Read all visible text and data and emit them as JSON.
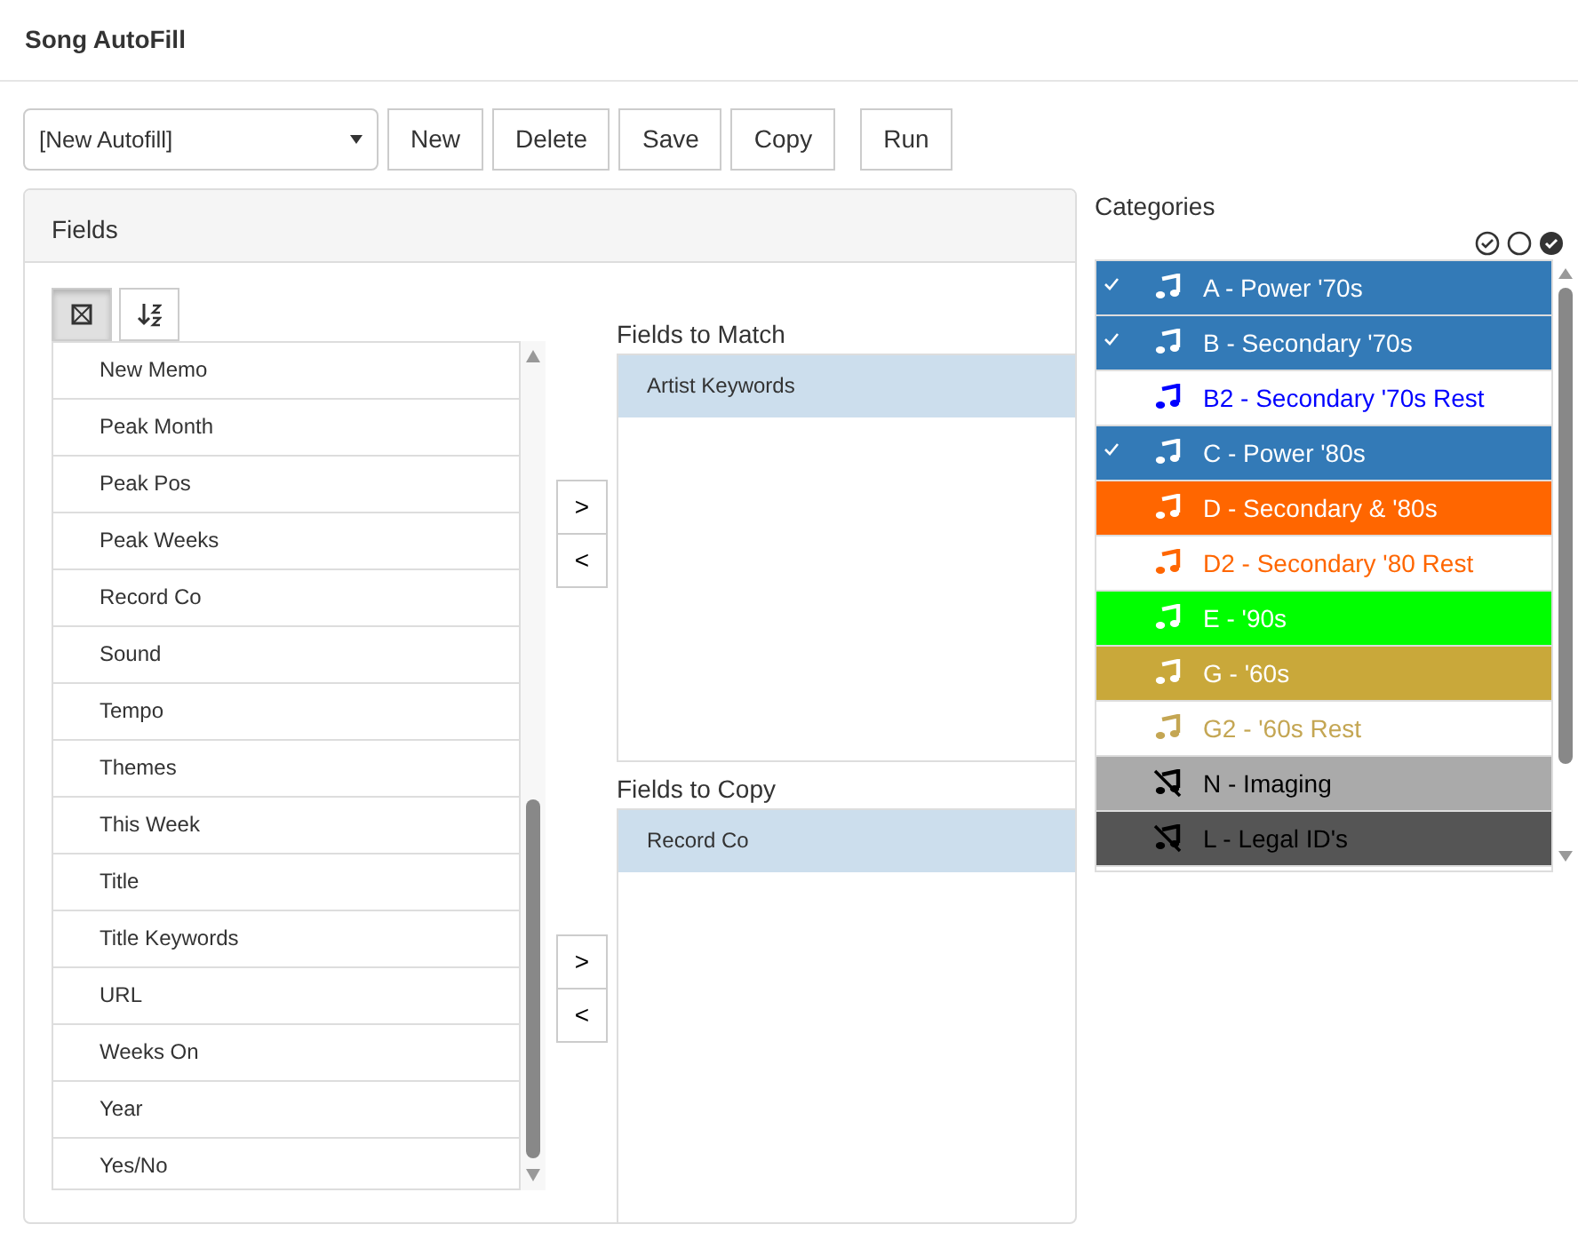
{
  "window": {
    "title": "Song AutoFill"
  },
  "toolbar": {
    "autofill_select": "[New Autofill]",
    "buttons": [
      "New",
      "Delete",
      "Save",
      "Copy",
      "Run"
    ]
  },
  "fields_panel": {
    "title": "Fields",
    "list_tools": [
      {
        "kind": "fit",
        "selected": true
      },
      {
        "kind": "sort",
        "selected": false
      }
    ],
    "available_fields": [
      "New Memo",
      "Peak Month",
      "Peak Pos",
      "Peak Weeks",
      "Record Co",
      "Sound",
      "Tempo",
      "Themes",
      "This Week",
      "Title",
      "Title Keywords",
      "URL",
      "Weeks On",
      "Year",
      "Yes/No"
    ],
    "match": {
      "label": "Fields to Match",
      "items": [
        "Artist Keywords"
      ],
      "buttons": [
        ">",
        "<"
      ]
    },
    "copy": {
      "label": "Fields to Copy",
      "items": [
        "Record Co"
      ],
      "buttons": [
        ">",
        "<"
      ]
    }
  },
  "categories": {
    "title": "Categories",
    "items": [
      {
        "label": "A - Power '70s",
        "selected": true,
        "kind": "fill",
        "muted": false
      },
      {
        "label": "B - Secondary '70s",
        "selected": true,
        "kind": "fill",
        "muted": false
      },
      {
        "label": "B2 - Secondary '70s Rest",
        "selected": false,
        "kind": "text",
        "color": "#0000ff",
        "muted": false
      },
      {
        "label": "C - Power '80s",
        "selected": true,
        "kind": "fill",
        "muted": false
      },
      {
        "label": "D - Secondary & '80s",
        "selected": false,
        "kind": "fill",
        "color": "#ff6600",
        "muted": false
      },
      {
        "label": "D2 - Secondary '80 Rest",
        "selected": false,
        "kind": "text",
        "color": "#ff6600",
        "muted": false
      },
      {
        "label": "E - '90s",
        "selected": false,
        "kind": "fill",
        "color": "#00ff00",
        "muted": false
      },
      {
        "label": "G - '60s",
        "selected": false,
        "kind": "fill",
        "color": "#c9a83a",
        "muted": false
      },
      {
        "label": "G2 - '60s Rest",
        "selected": false,
        "kind": "text",
        "color": "#c4a653",
        "muted": false
      },
      {
        "label": "N - Imaging",
        "selected": false,
        "kind": "fill",
        "color": "#aaaaaa",
        "muted": true
      },
      {
        "label": "L - Legal ID's",
        "selected": false,
        "kind": "fill",
        "color": "#555555",
        "muted": true
      }
    ]
  }
}
